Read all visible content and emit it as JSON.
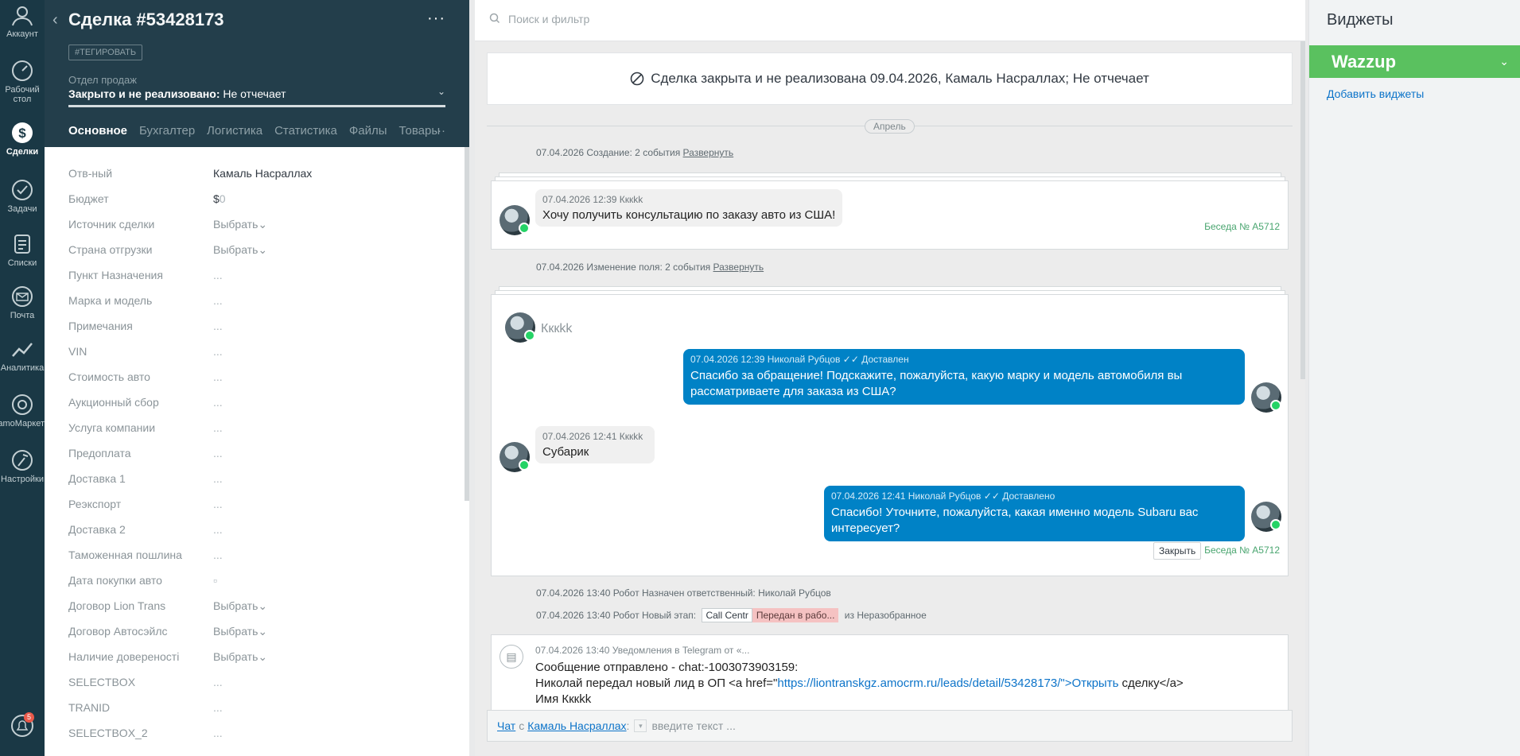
{
  "nav": {
    "items": [
      {
        "label": "Аккаунт"
      },
      {
        "label": "Рабочий стол"
      },
      {
        "label": "Сделки"
      },
      {
        "label": "Задачи"
      },
      {
        "label": "Списки"
      },
      {
        "label": "Почта"
      },
      {
        "label": "Аналитика"
      },
      {
        "label": "amoМаркет"
      },
      {
        "label": "Настройки"
      }
    ],
    "notifications_badge": "5"
  },
  "card": {
    "title": "Сделка #53428173",
    "more": "···",
    "tag_button": "#ТЕГИРОВАТЬ",
    "pipeline": "Отдел продаж",
    "status_bold": "Закрыто и не реализовано:",
    "status_reason": "Не отчечает",
    "tabs": [
      "Основное",
      "Бухгалтерия",
      "Логистика",
      "Статистика",
      "Файлы",
      "Товары"
    ],
    "tabs_more": "···",
    "fields": [
      {
        "label": "Отв-ный",
        "value": "Камаль Насраллах",
        "kind": "text"
      },
      {
        "label": "Бюджет",
        "value": "$",
        "extra": "0",
        "kind": "budget"
      },
      {
        "label": "Источник сделки",
        "value": "Выбрать",
        "kind": "select"
      },
      {
        "label": "Страна отгрузки",
        "value": "Выбрать",
        "kind": "select"
      },
      {
        "label": "Пункт Назначения",
        "value": "...",
        "kind": "muted"
      },
      {
        "label": "Марка и модель",
        "value": "...",
        "kind": "muted"
      },
      {
        "label": "Примечания",
        "value": "...",
        "kind": "muted"
      },
      {
        "label": "VIN",
        "value": "...",
        "kind": "muted"
      },
      {
        "label": "Стоимость авто",
        "value": "...",
        "kind": "muted"
      },
      {
        "label": "Аукционный сбор",
        "value": "...",
        "kind": "muted"
      },
      {
        "label": "Услуга компании",
        "value": "...",
        "kind": "muted"
      },
      {
        "label": "Предоплата",
        "value": "...",
        "kind": "muted"
      },
      {
        "label": "Доставка 1",
        "value": "...",
        "kind": "muted"
      },
      {
        "label": "Реэкспорт",
        "value": "...",
        "kind": "muted"
      },
      {
        "label": "Доставка 2",
        "value": "...",
        "kind": "muted"
      },
      {
        "label": "Таможенная пошлина",
        "value": "...",
        "kind": "muted"
      },
      {
        "label": "Дата покупки авто",
        "value": "▫",
        "kind": "muted"
      },
      {
        "label": "Договор Lion Trans",
        "value": "Выбрать",
        "kind": "select"
      },
      {
        "label": "Договор Автосэйлс",
        "value": "Выбрать",
        "kind": "select"
      },
      {
        "label": "Наличие довереності",
        "value": "Выбрать",
        "kind": "select"
      },
      {
        "label": "SELECTBOX",
        "value": "...",
        "kind": "muted"
      },
      {
        "label": "TRANID",
        "value": "...",
        "kind": "muted"
      },
      {
        "label": "SELECTBOX_2",
        "value": "...",
        "kind": "muted"
      }
    ]
  },
  "feed": {
    "search_placeholder": "Поиск и фильтр",
    "closed_banner": "Сделка закрыта и не реализована 09.04.2026, Камаль Насраллах; Не отчечает",
    "month": "Апрель",
    "event1": {
      "text": "07.04.2026 Создание: 2 события",
      "link": "Развернуть"
    },
    "chat1": {
      "meta": "07.04.2026 12:39 Кккkk",
      "text": "Хочу получить консультацию по заказу авто из США!",
      "conversation": "Беседа № A5712"
    },
    "event2": {
      "text": "07.04.2026 Изменение поля: 2 события",
      "link": "Развернуть"
    },
    "chat2": {
      "contact_name": "Кккkk",
      "msg1_meta": "07.04.2026 12:39 Николай Рубцов ✓✓ Доставлен",
      "msg1_text": "Спасибо за обращение! Подскажите, пожалуйста, какую марку и модель автомобиля вы рассматриваете для заказа из США?",
      "msg2_meta": "07.04.2026 12:41 Кккkk",
      "msg2_text": "Субарик",
      "msg3_meta": "07.04.2026 12:41 Николай Рубцов ✓✓ Доставлено",
      "msg3_text": "Спасибо! Уточните, пожалуйста, какая именно модель Subaru вас интересует?",
      "close_button": "Закрыть",
      "conversation": "Беседа № A5712"
    },
    "robot1": "07.04.2026 13:40 Робот Назначен ответственный: Николай Рубцов",
    "robot2": {
      "prefix": "07.04.2026 13:40 Робот Новый этап:",
      "chip1": "Call Centr",
      "chip2": "Передан в рабо...",
      "suffix": "из Неразобранное"
    },
    "notification": {
      "meta": "07.04.2026 13:40 Уведомления в Telegram от «...",
      "line1": "Сообщение отправлено - chat:-1003073903159:",
      "line2_pre": "Николай передал новый лид в ОП <a href=\"",
      "line2_link": "https://liontranskgz.amocrm.ru/leads/detail/53428173/\">Открыть",
      "line2_post": " сделку</a>",
      "line3": "Имя Кккkk"
    },
    "composer": {
      "chat_label": "Чат",
      "with": "с",
      "contact": "Камаль Насраллах",
      "colon": ":",
      "placeholder": "введите текст ..."
    }
  },
  "widgets": {
    "title": "Виджеты",
    "wazzup": "Wazzup",
    "add_link": "Добавить виджеты"
  },
  "colors": {
    "nav_bg": "#1a3845",
    "card_header": "#233e4b",
    "outgoing_bubble": "#0082c6",
    "wazzup_green": "#5ac15f",
    "link": "#0d74c9"
  }
}
